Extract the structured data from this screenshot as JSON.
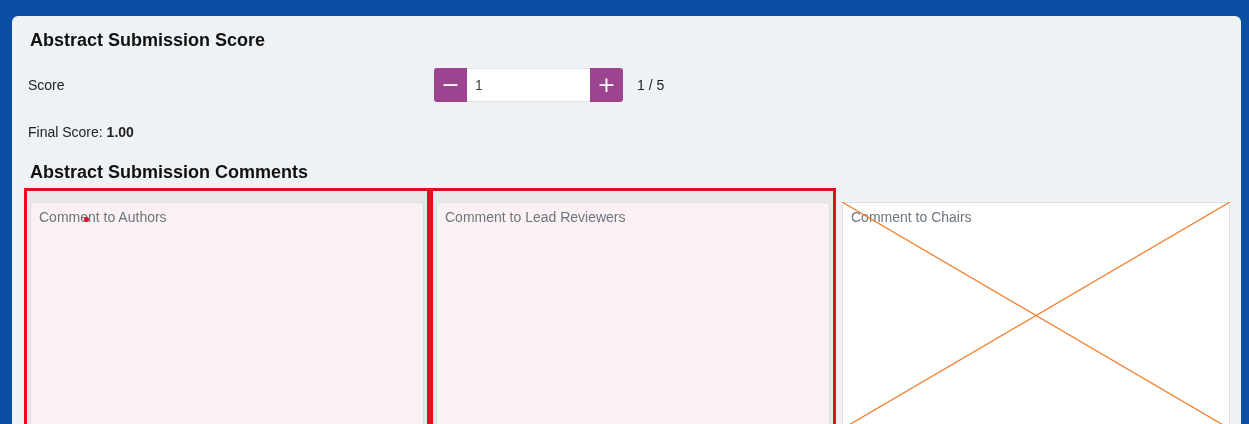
{
  "score_section": {
    "title": "Abstract Submission Score",
    "score": {
      "label": "Score",
      "value": "1",
      "decrement": "−",
      "increment": "+",
      "range": "1 / 5"
    },
    "final_score": {
      "label": "Final Score:",
      "value": "1.00"
    }
  },
  "comments_section": {
    "title": "Abstract Submission Comments",
    "fields": [
      {
        "placeholder": "Comment to Authors",
        "kind": "outlined",
        "dot": true
      },
      {
        "placeholder": "Comment to Lead Reviewers",
        "kind": "outlined",
        "dot": false
      },
      {
        "placeholder": "Comment to Chairs",
        "kind": "crossed",
        "dot": false
      }
    ]
  }
}
